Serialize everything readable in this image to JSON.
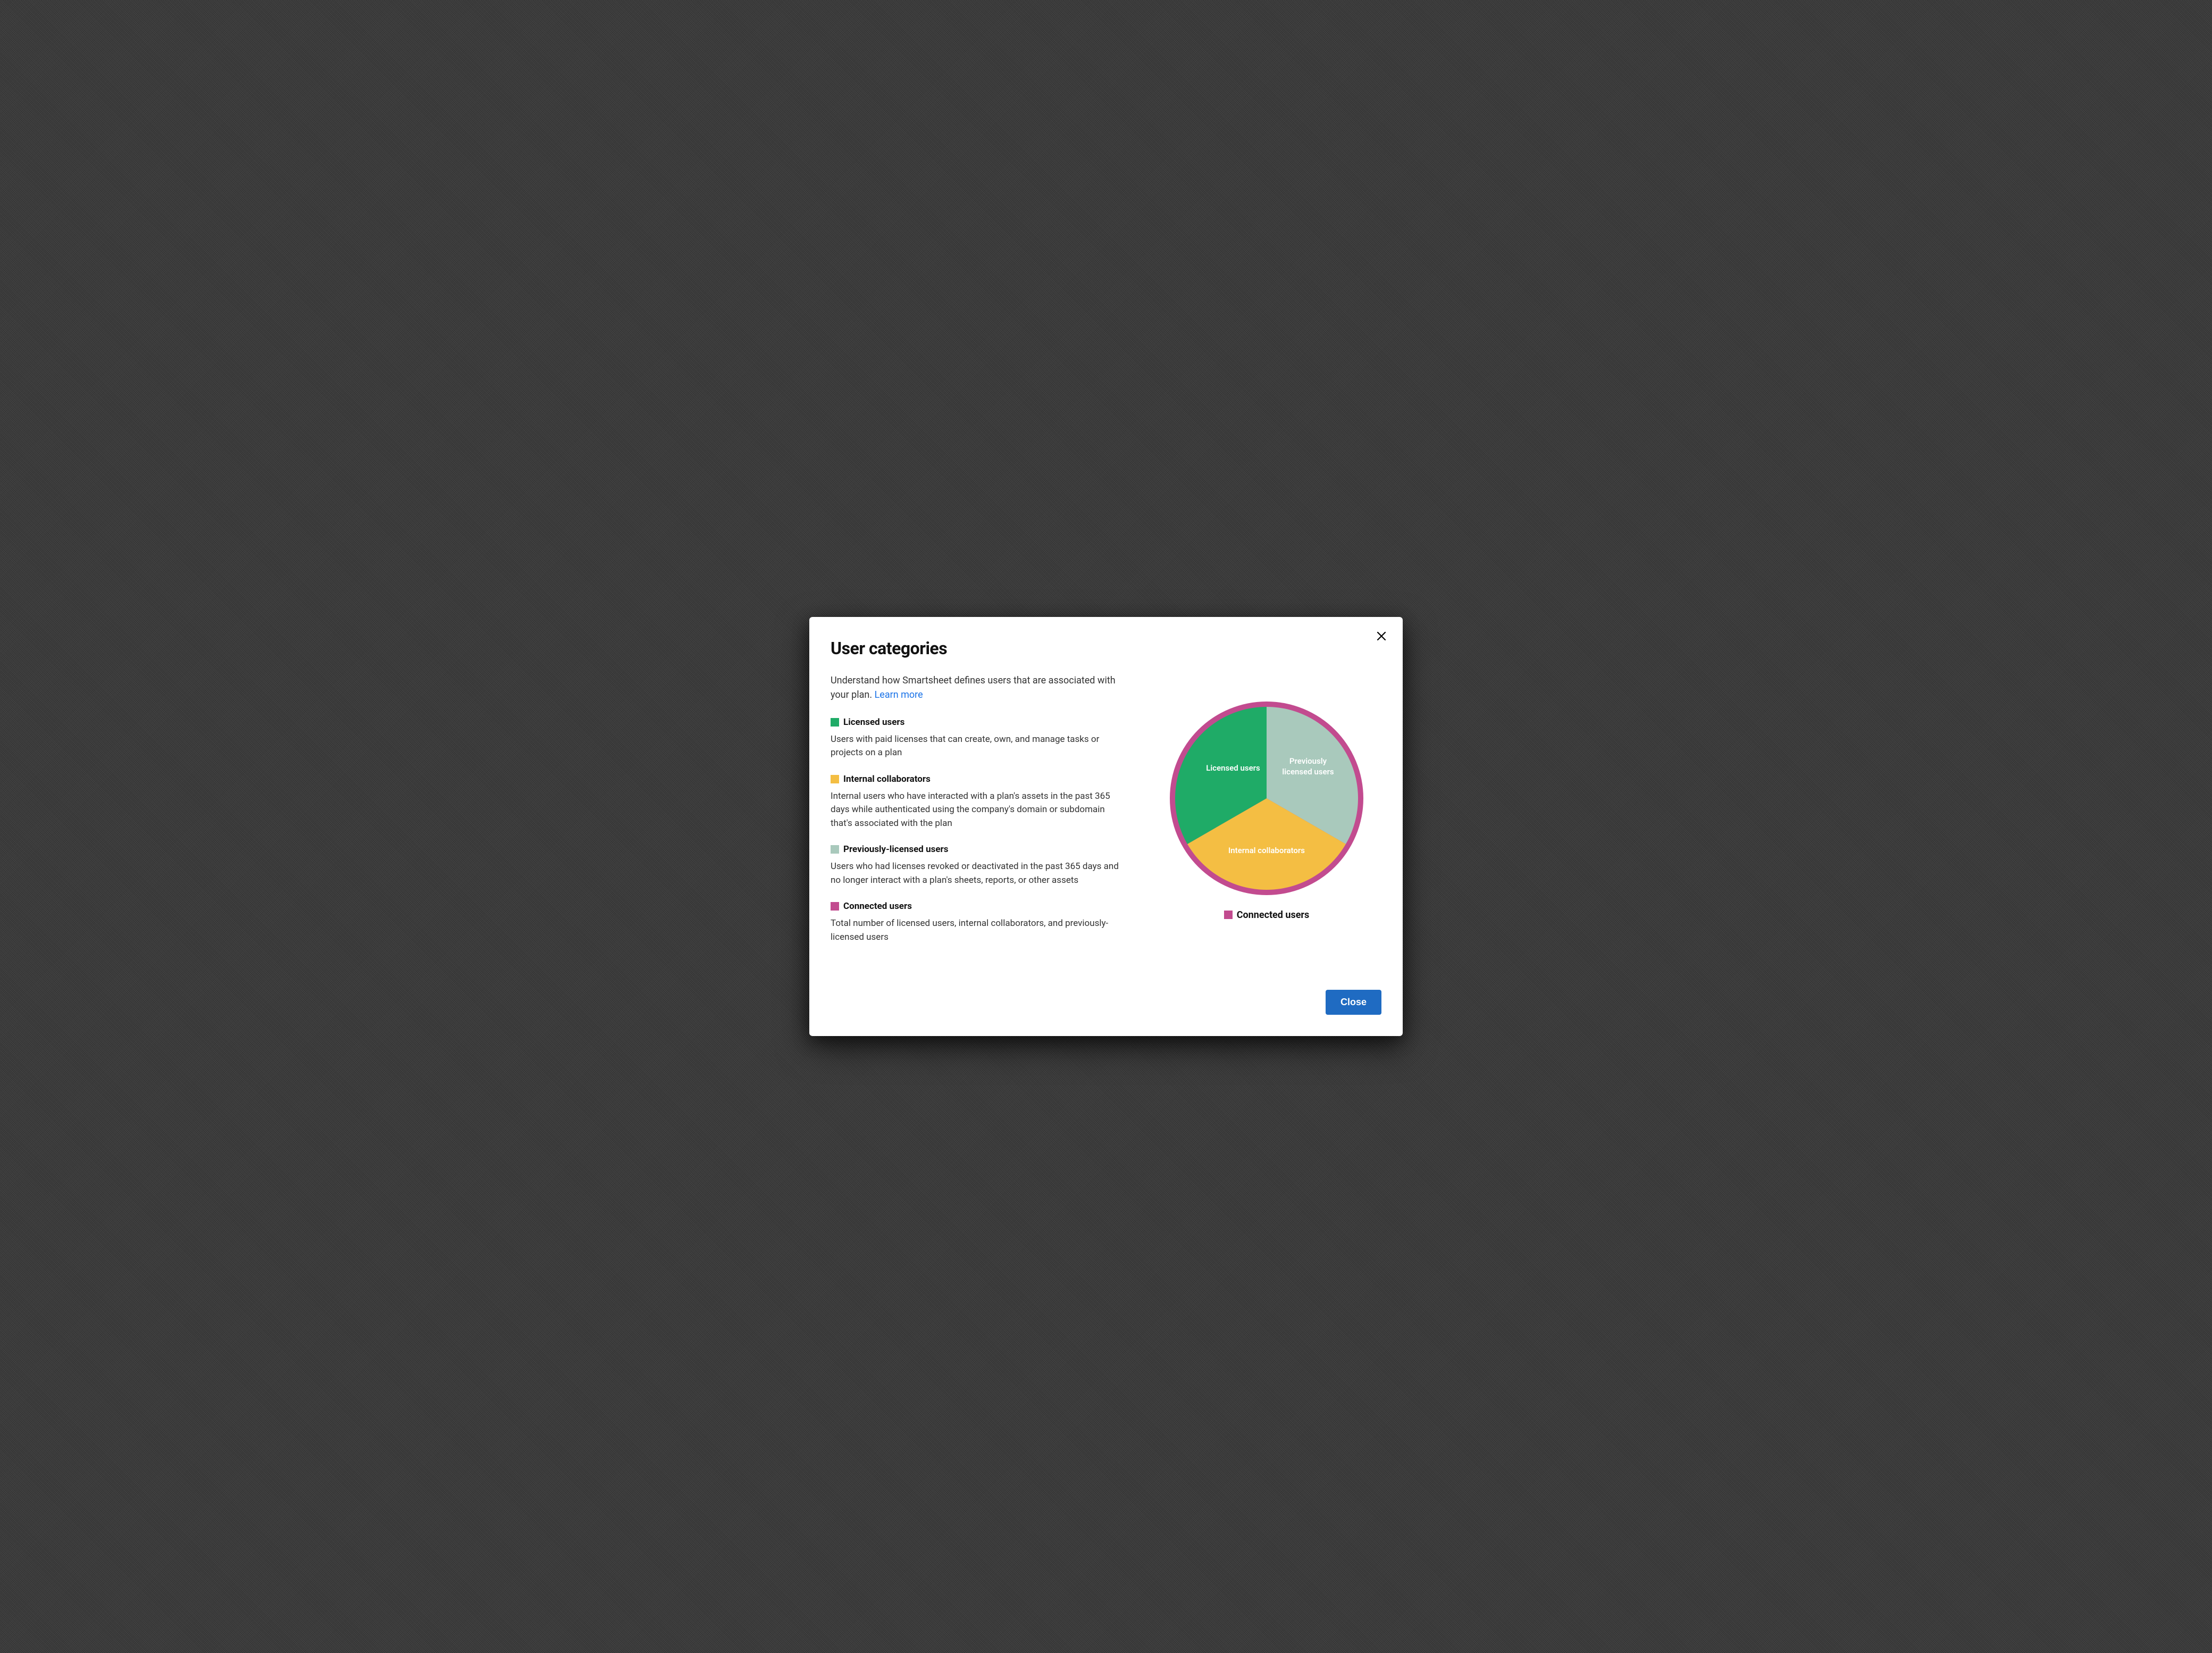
{
  "modal": {
    "title": "User categories",
    "intro": "Understand how Smartsheet defines users that are associated with your plan. ",
    "learn_more_label": "Learn more",
    "close_button_label": "Close"
  },
  "categories": [
    {
      "name": "Licensed users",
      "color": "#1fab67",
      "description": "Users with paid licenses that can create, own, and manage tasks or projects on a plan"
    },
    {
      "name": "Internal collaborators",
      "color": "#f4be43",
      "description": "Internal users who have interacted with a plan's assets in the past 365 days while authenticated using the company's domain or subdomain that's associated with the plan"
    },
    {
      "name": "Previously-licensed users",
      "color": "#a9c9bc",
      "description": "Users who had licenses revoked or deactivated in the past 365 days and no longer interact with a plan's sheets, reports, or other assets"
    },
    {
      "name": "Connected users",
      "color": "#c24b8f",
      "description": "Total number of licensed users, internal collaborators, and previously-licensed users"
    }
  ],
  "chart_data": {
    "type": "pie",
    "title": "",
    "series": [
      {
        "name": "Licensed users",
        "value": 33.33,
        "color": "#1fab67"
      },
      {
        "name": "Previously licensed users",
        "value": 33.33,
        "color": "#a9c9bc"
      },
      {
        "name": "Internal collaborators",
        "value": 33.33,
        "color": "#f4be43"
      }
    ],
    "ring_label": "Connected users",
    "ring_color": "#c24b8f"
  }
}
